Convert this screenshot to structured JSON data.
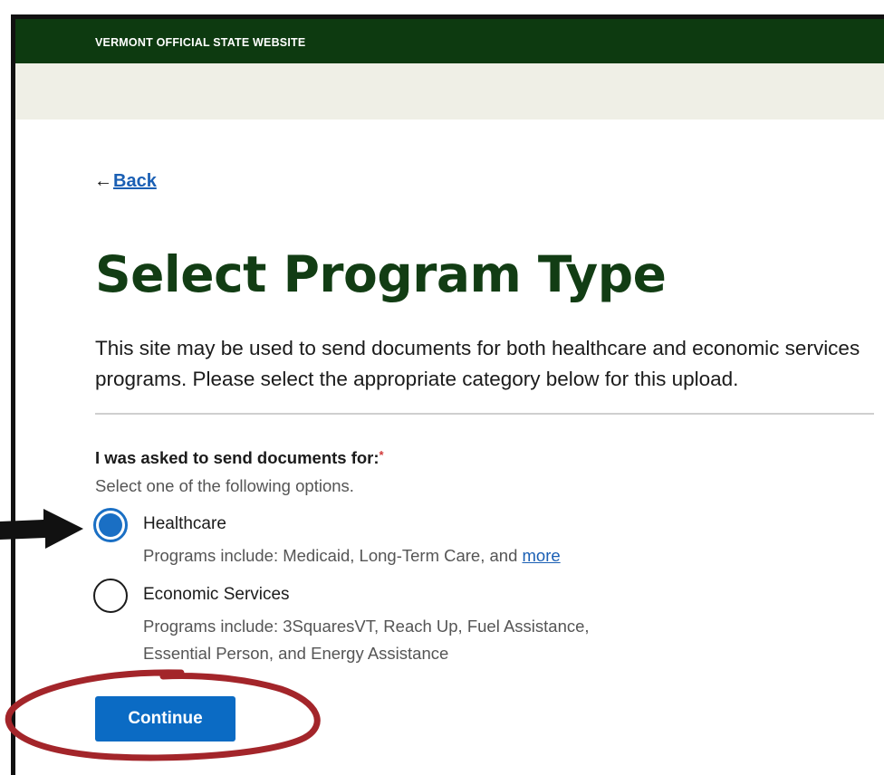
{
  "gov_banner": {
    "text": "VERMONT OFFICIAL STATE WEBSITE"
  },
  "nav": {
    "back_label": "Back",
    "back_arrow": "←"
  },
  "page": {
    "title": "Select Program Type",
    "intro": "This site may be used to send documents for both healthcare and economic services programs. Please select the appropriate category below for this upload."
  },
  "question": {
    "label": "I was asked to send documents for:",
    "required_marker": "*",
    "hint": "Select one of the following options."
  },
  "options": [
    {
      "title": "Healthcare",
      "desc_prefix": "Programs include: Medicaid, Long-Term Care, and ",
      "desc_link": "more",
      "selected": true
    },
    {
      "title": "Economic Services",
      "desc_line1": "Programs include: 3SquaresVT, Reach Up, Fuel Assistance,",
      "desc_line2": "Essential Person, and Energy Assistance",
      "selected": false
    }
  ],
  "actions": {
    "continue_label": "Continue"
  },
  "colors": {
    "gov_bar": "#0d3a10",
    "title": "#123d14",
    "primary": "#0b6bc4",
    "annotation_red": "#a3252a",
    "annotation_arrow": "#111111"
  }
}
